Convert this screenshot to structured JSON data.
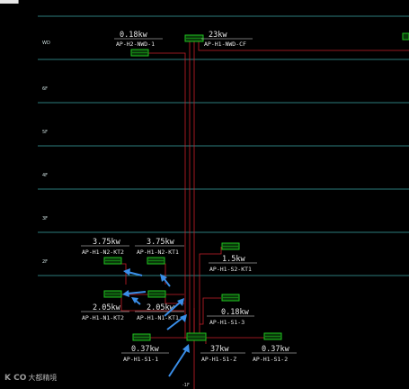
{
  "floors": [
    "WD",
    "6F",
    "5F",
    "4F",
    "3F",
    "2F"
  ],
  "panels": [
    {
      "id": "hz-nwd-1",
      "power": "0.18kw",
      "code": "AP-H2-NWD-1"
    },
    {
      "id": "h1-nwd-cf",
      "power": "23kw",
      "code": "AP-H1-NWD-CF"
    },
    {
      "id": "h1-n2-kt2",
      "power": "3.75kw",
      "code": "AP-H1-N2-KT2"
    },
    {
      "id": "h1-n2-kt1",
      "power": "3.75kw",
      "code": "AP-H1-N2-KT1"
    },
    {
      "id": "h1-s2-kt1",
      "power": "1.5kw",
      "code": "AP-H1-S2-KT1"
    },
    {
      "id": "h1-n1-kt2",
      "power": "2.05kw",
      "code": "AP-H1-N1-KT2"
    },
    {
      "id": "h1-n1-kt1",
      "power": "2.05kw",
      "code": "AP-H1-N1-KT1"
    },
    {
      "id": "h1-s1-3",
      "power": "0.18kw",
      "code": "AP-H1-S1-3"
    },
    {
      "id": "h1-s1-1",
      "power": "0.37kw",
      "code": "AP-H1-S1-1"
    },
    {
      "id": "h1-s1-z",
      "power": "37kw",
      "code": "AP-H1-S1-Z"
    },
    {
      "id": "h1-s1-2",
      "power": "0.37kw",
      "code": "AP-H1-S1-2"
    }
  ],
  "watermark": {
    "logo": "K CO",
    "text": "大都精境"
  },
  "bottom_note": "-1F"
}
